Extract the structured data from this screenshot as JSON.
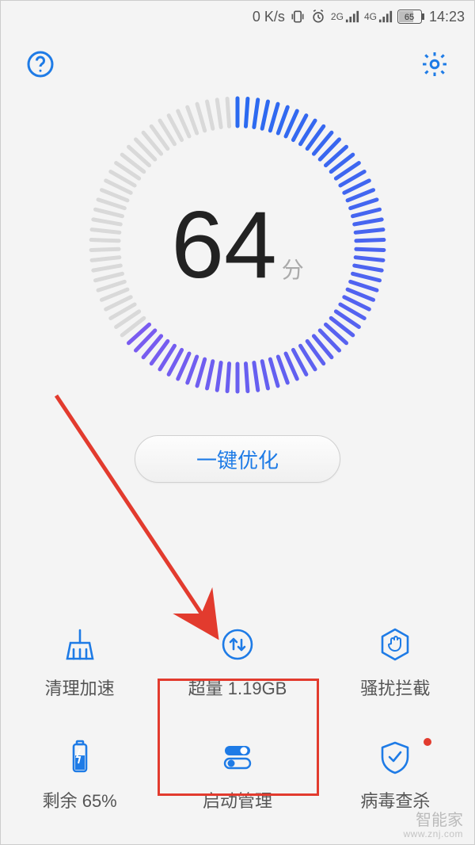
{
  "status": {
    "net_speed": "0 K/s",
    "sig2g": "2G",
    "sig4g": "4G",
    "battery_pct": "65",
    "time": "14:23"
  },
  "dial": {
    "score": "64",
    "unit": "分",
    "pct": 64
  },
  "optimize_label": "一键优化",
  "grid": {
    "clean": {
      "label": "清理加速"
    },
    "traffic": {
      "label_prefix": "超量",
      "value": "1.19GB"
    },
    "harass": {
      "label": "骚扰拦截"
    },
    "battery": {
      "label_prefix": "剩余",
      "value": "65%"
    },
    "launch": {
      "label": "启动管理"
    },
    "virus": {
      "label": "病毒查杀"
    }
  },
  "watermark": {
    "line1": "智能家",
    "line2": "www.znj.com"
  },
  "colors": {
    "accent": "#1e7be6",
    "dial_start": "#2a6af0",
    "dial_end": "#7a5cf0",
    "danger": "#e23b2e"
  }
}
